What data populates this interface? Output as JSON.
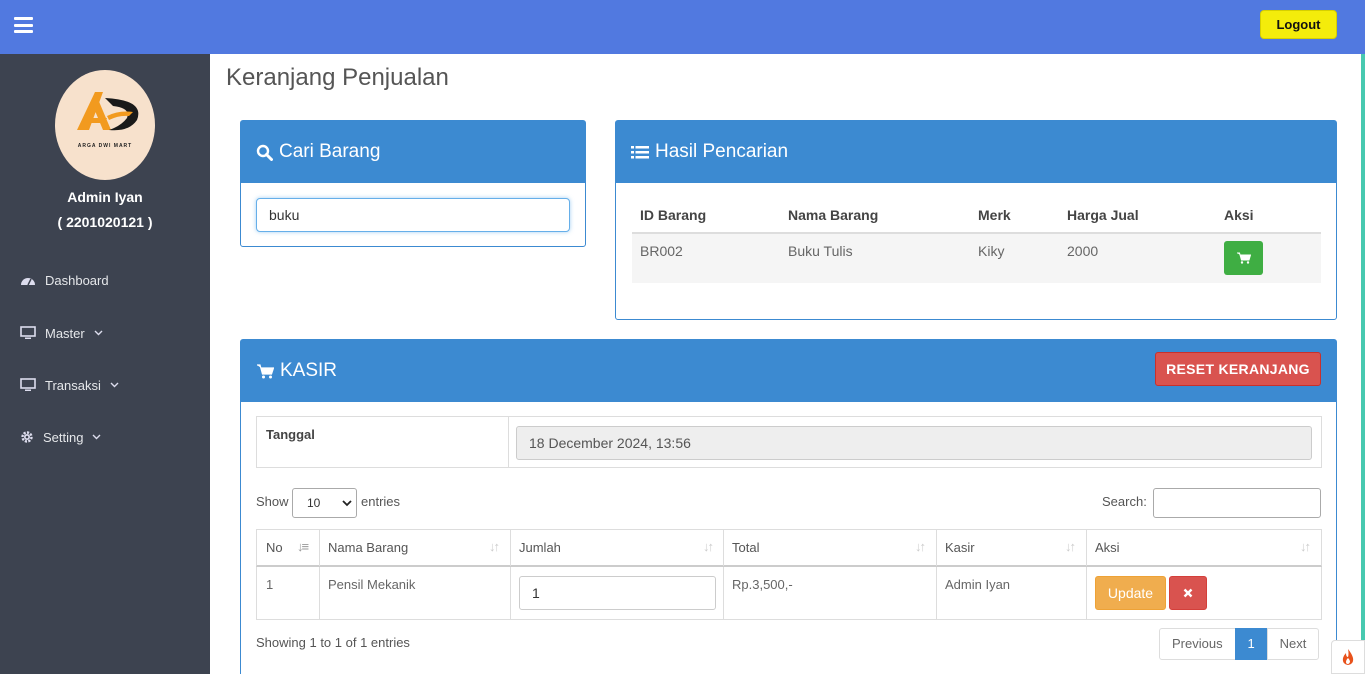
{
  "topbar": {
    "logout_label": "Logout",
    "accent": "#5179e0",
    "logout_color": "#f4ec0b"
  },
  "sidebar": {
    "logo_text": "ARGA DWI MART",
    "user_name": "Admin Iyan",
    "user_id": "( 2201020121 )",
    "items": [
      {
        "label": "Dashboard",
        "icon": "dashboard-icon"
      },
      {
        "label": "Master",
        "icon": "monitor-icon"
      },
      {
        "label": "Transaksi",
        "icon": "monitor-icon"
      },
      {
        "label": "Setting",
        "icon": "gear-icon"
      }
    ]
  },
  "page": {
    "title": "Keranjang Penjualan"
  },
  "search_box": {
    "title": "Cari Barang",
    "query": "buku"
  },
  "results_box": {
    "title": "Hasil Pencarian",
    "columns": [
      "ID Barang",
      "Nama Barang",
      "Merk",
      "Harga Jual",
      "Aksi"
    ],
    "rows": [
      {
        "id": "BR002",
        "name": "Buku Tulis",
        "merk": "Kiky",
        "price": "2000"
      }
    ]
  },
  "kasir": {
    "title": "KASIR",
    "reset_label": "RESET KERANJANG",
    "date_label": "Tanggal",
    "date_value": "18 December 2024, 13:56",
    "show_label": "Show",
    "page_size": "10",
    "entries_label": "entries",
    "search_label": "Search:",
    "columns": [
      "No",
      "Nama Barang",
      "Jumlah",
      "Total",
      "Kasir",
      "Aksi"
    ],
    "rows": [
      {
        "no": "1",
        "name": "Pensil Mekanik",
        "qty": "1",
        "total": "Rp.3,500,-",
        "cashier": "Admin Iyan",
        "update_label": "Update"
      }
    ],
    "info": "Showing 1 to 1 of 1 entries",
    "pager": {
      "previous": "Previous",
      "current": "1",
      "next": "Next"
    }
  }
}
